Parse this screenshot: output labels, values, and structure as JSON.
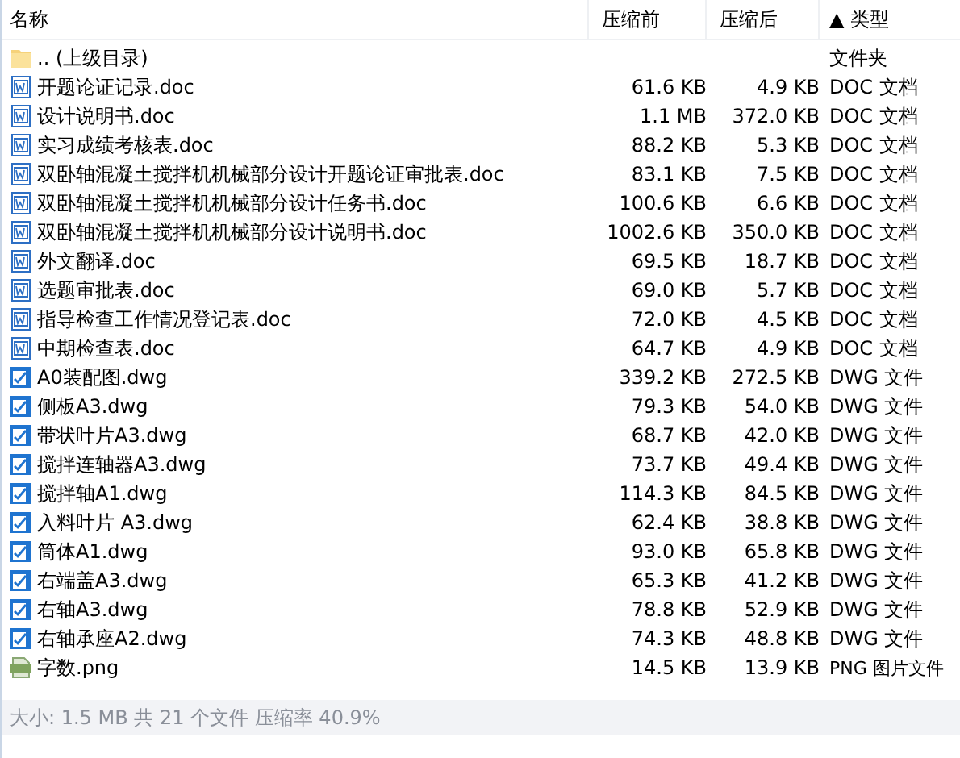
{
  "columns": [
    {
      "label": "名称"
    },
    {
      "label": "压缩前"
    },
    {
      "label": "压缩后"
    },
    {
      "label": "类型",
      "sort_indicator": "▲"
    }
  ],
  "rows": [
    {
      "kind": "folder",
      "name": ".. (上级目录)",
      "type": "文件夹"
    },
    {
      "kind": "doc",
      "name": "开题论证记录.doc",
      "size": "61.6 KB",
      "packed": "4.9 KB",
      "type": "DOC 文档"
    },
    {
      "kind": "doc",
      "name": "设计说明书.doc",
      "size": "1.1 MB",
      "packed": "372.0 KB",
      "type": "DOC 文档"
    },
    {
      "kind": "doc",
      "name": "实习成绩考核表.doc",
      "size": "88.2 KB",
      "packed": "5.3 KB",
      "type": "DOC 文档"
    },
    {
      "kind": "doc",
      "name": "双卧轴混凝土搅拌机机械部分设计开题论证审批表.doc",
      "size": "83.1 KB",
      "packed": "7.5 KB",
      "type": "DOC 文档"
    },
    {
      "kind": "doc",
      "name": "双卧轴混凝土搅拌机机械部分设计任务书.doc",
      "size": "100.6 KB",
      "packed": "6.6 KB",
      "type": "DOC 文档"
    },
    {
      "kind": "doc",
      "name": "双卧轴混凝土搅拌机机械部分设计说明书.doc",
      "size": "1002.6 KB",
      "packed": "350.0 KB",
      "type": "DOC 文档"
    },
    {
      "kind": "doc",
      "name": "外文翻译.doc",
      "size": "69.5 KB",
      "packed": "18.7 KB",
      "type": "DOC 文档"
    },
    {
      "kind": "doc",
      "name": "选题审批表.doc",
      "size": "69.0 KB",
      "packed": "5.7 KB",
      "type": "DOC 文档"
    },
    {
      "kind": "doc",
      "name": "指导检查工作情况登记表.doc",
      "size": "72.0 KB",
      "packed": "4.5 KB",
      "type": "DOC 文档"
    },
    {
      "kind": "doc",
      "name": "中期检查表.doc",
      "size": "64.7 KB",
      "packed": "4.9 KB",
      "type": "DOC 文档"
    },
    {
      "kind": "dwg",
      "name": "A0装配图.dwg",
      "size": "339.2 KB",
      "packed": "272.5 KB",
      "type": "DWG 文件"
    },
    {
      "kind": "dwg",
      "name": "侧板A3.dwg",
      "size": "79.3 KB",
      "packed": "54.0 KB",
      "type": "DWG 文件"
    },
    {
      "kind": "dwg",
      "name": "带状叶片A3.dwg",
      "size": "68.7 KB",
      "packed": "42.0 KB",
      "type": "DWG 文件"
    },
    {
      "kind": "dwg",
      "name": "搅拌连轴器A3.dwg",
      "size": "73.7 KB",
      "packed": "49.4 KB",
      "type": "DWG 文件"
    },
    {
      "kind": "dwg",
      "name": "搅拌轴A1.dwg",
      "size": "114.3 KB",
      "packed": "84.5 KB",
      "type": "DWG 文件"
    },
    {
      "kind": "dwg",
      "name": "入料叶片 A3.dwg",
      "size": "62.4 KB",
      "packed": "38.8 KB",
      "type": "DWG 文件"
    },
    {
      "kind": "dwg",
      "name": "筒体A1.dwg",
      "size": "93.0 KB",
      "packed": "65.8 KB",
      "type": "DWG 文件"
    },
    {
      "kind": "dwg",
      "name": "右端盖A3.dwg",
      "size": "65.3 KB",
      "packed": "41.2 KB",
      "type": "DWG 文件"
    },
    {
      "kind": "dwg",
      "name": "右轴A3.dwg",
      "size": "78.8 KB",
      "packed": "52.9 KB",
      "type": "DWG 文件"
    },
    {
      "kind": "dwg",
      "name": "右轴承座A2.dwg",
      "size": "74.3 KB",
      "packed": "48.8 KB",
      "type": "DWG 文件"
    },
    {
      "kind": "png",
      "name": "字数.png",
      "size": "14.5 KB",
      "packed": "13.9 KB",
      "type": "PNG 图片文件"
    }
  ],
  "status_bar": "大小: 1.5 MB 共 21 个文件 压缩率 40.9%"
}
